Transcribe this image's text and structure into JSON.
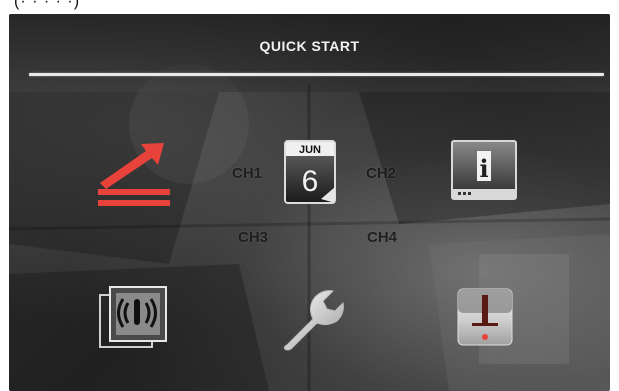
{
  "top_fragment": "(· · · · ·)",
  "dialog": {
    "title": "QUICK START"
  },
  "channels": [
    {
      "label": "CH1"
    },
    {
      "label": "CH2"
    },
    {
      "label": "CH3"
    },
    {
      "label": "CH4"
    }
  ],
  "menu": {
    "items": [
      {
        "name": "connection-setup",
        "icon": "arrows-swap-icon",
        "selected": true,
        "accent": "#e8433a"
      },
      {
        "name": "date-time-setup",
        "icon": "calendar-icon",
        "calendar_month": "JUN",
        "calendar_day": "6"
      },
      {
        "name": "system-info",
        "icon": "info-monitor-icon",
        "info_glyph": "i"
      },
      {
        "name": "record-setup",
        "icon": "camera-signal-icon"
      },
      {
        "name": "tools-setup",
        "icon": "wrench-icon"
      },
      {
        "name": "alarm-setup",
        "icon": "alarm-icon"
      }
    ]
  },
  "colors": {
    "accent": "#e8433a",
    "title": "#f2f2f2",
    "divider": "#e9e9e9"
  }
}
